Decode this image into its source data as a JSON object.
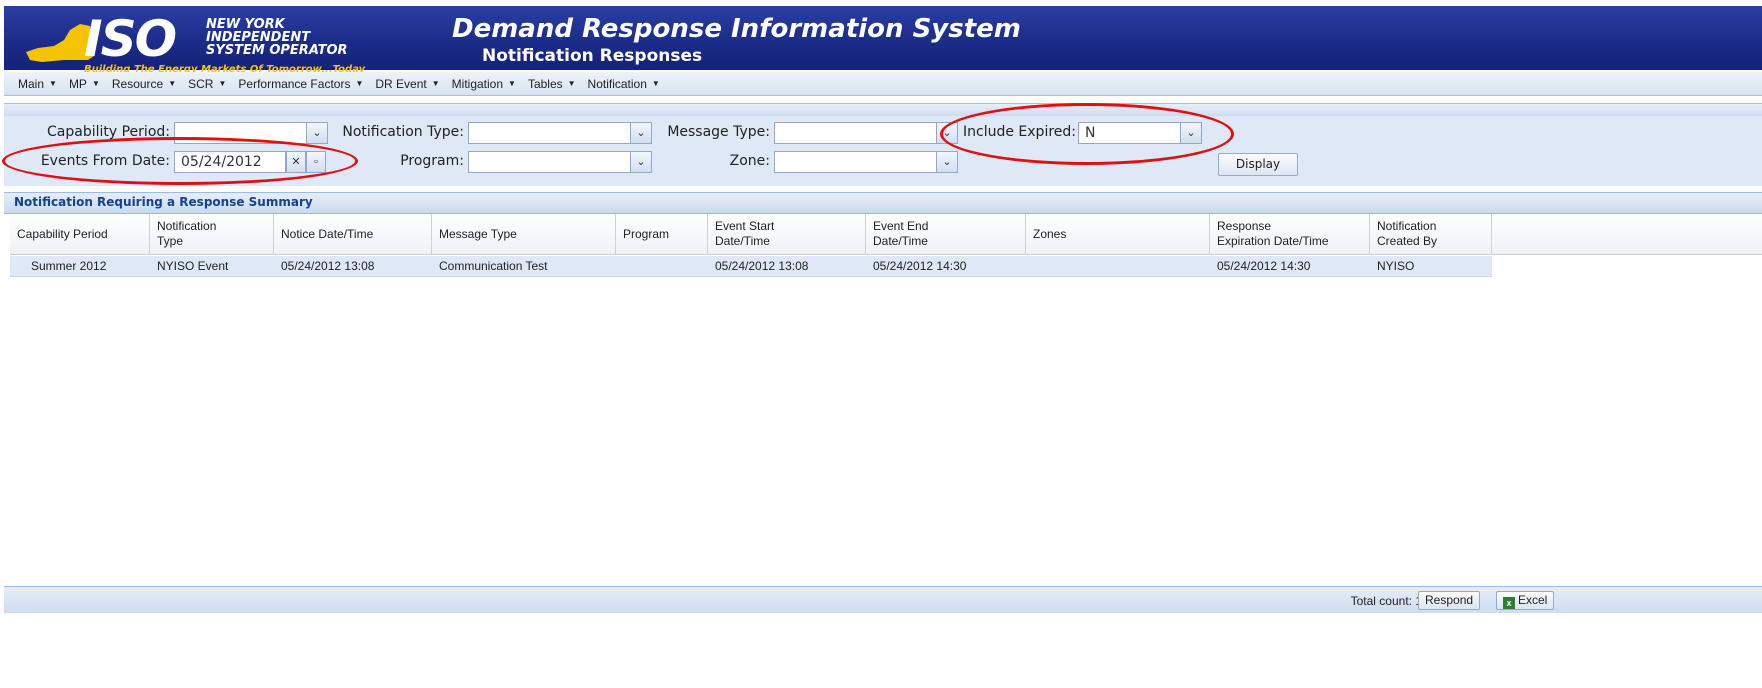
{
  "header": {
    "logo_text": "ISO",
    "org_line1": "NEW YORK",
    "org_line2": "INDEPENDENT",
    "org_line3": "SYSTEM OPERATOR",
    "tagline": "Building The Energy Markets Of Tomorrow...Today",
    "app_title": "Demand Response Information System",
    "page_title": "Notification Responses",
    "colors": {
      "banner": "#1c2c8a",
      "tagline": "#f5c400",
      "logo_state": "#f5c400"
    }
  },
  "menu": [
    "Main",
    "MP",
    "Resource",
    "SCR",
    "Performance Factors",
    "DR Event",
    "Mitigation",
    "Tables",
    "Notification"
  ],
  "filters": {
    "capability_period": {
      "label": "Capability Period:",
      "value": ""
    },
    "notification_type": {
      "label": "Notification Type:",
      "value": ""
    },
    "message_type": {
      "label": "Message Type:",
      "value": ""
    },
    "include_expired": {
      "label": "Include Expired:",
      "value": "N"
    },
    "events_from_date": {
      "label": "Events From Date:",
      "value": "05/24/2012"
    },
    "program": {
      "label": "Program:",
      "value": ""
    },
    "zone": {
      "label": "Zone:",
      "value": ""
    },
    "display_button": "Display"
  },
  "grid": {
    "title": "Notification Requiring a Response Summary",
    "columns": [
      "Capability Period",
      "Notification\nType",
      "Notice Date/Time",
      "Message Type",
      "Program",
      "Event Start\nDate/Time",
      "Event End\nDate/Time",
      "Zones",
      "Response\nExpiration Date/Time",
      "Notification\nCreated By"
    ],
    "rows": [
      [
        "Summer 2012",
        "NYISO Event",
        "05/24/2012 13:08",
        "Communication Test",
        "",
        "05/24/2012 13:08",
        "05/24/2012 14:30",
        "",
        "05/24/2012 14:30",
        "NYISO"
      ]
    ]
  },
  "footer": {
    "total_count": "Total count: 1",
    "respond_button": "Respond",
    "excel_button": "Excel"
  },
  "annotations": {
    "oval_color": "#e01010"
  }
}
